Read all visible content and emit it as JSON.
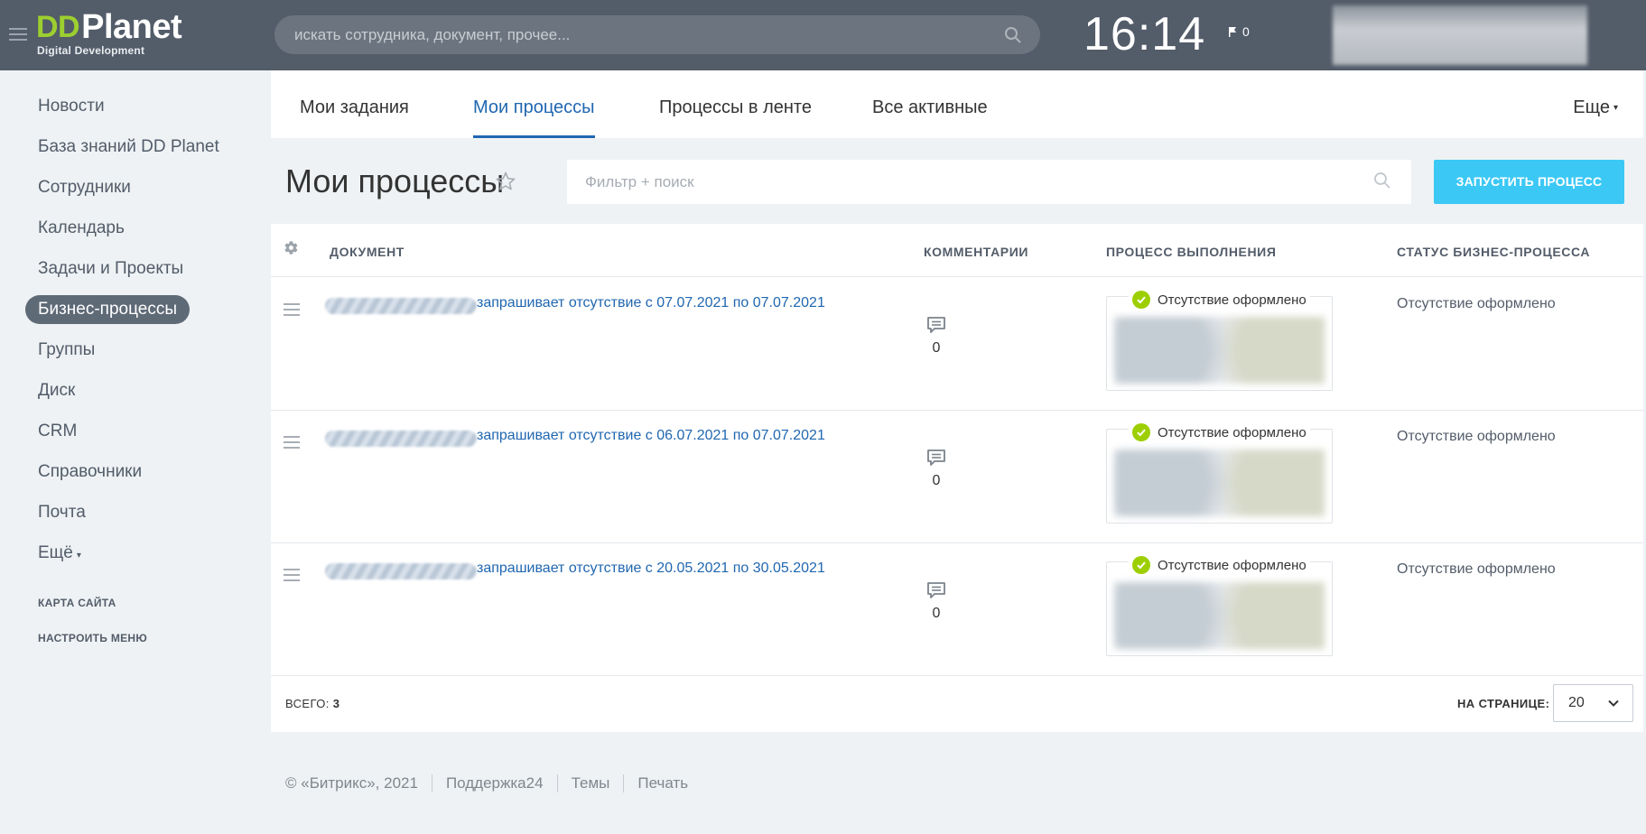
{
  "header": {
    "logo_dd": "DD",
    "logo_name": "Planet",
    "logo_sub": "Digital Development",
    "search_placeholder": "искать сотрудника, документ, прочее...",
    "time": "16:14",
    "flag_count": "0"
  },
  "sidebar": {
    "items": [
      {
        "label": "Новости"
      },
      {
        "label": "База знаний DD Planet"
      },
      {
        "label": "Сотрудники"
      },
      {
        "label": "Календарь"
      },
      {
        "label": "Задачи и Проекты"
      },
      {
        "label": "Бизнес-процессы"
      },
      {
        "label": "Группы"
      },
      {
        "label": "Диск"
      },
      {
        "label": "CRM"
      },
      {
        "label": "Справочники"
      },
      {
        "label": "Почта"
      },
      {
        "label": "Ещё"
      }
    ],
    "sitemap": "КАРТА САЙТА",
    "configure": "НАСТРОИТЬ МЕНЮ"
  },
  "tabs": {
    "items": [
      {
        "label": "Мои задания"
      },
      {
        "label": "Мои процессы"
      },
      {
        "label": "Процессы в ленте"
      },
      {
        "label": "Все активные"
      }
    ],
    "more": "Еще"
  },
  "page": {
    "title": "Мои процессы",
    "filter_placeholder": "Фильтр + поиск",
    "start_button": "ЗАПУСТИТЬ ПРОЦЕСС"
  },
  "grid": {
    "columns": {
      "document": "ДОКУМЕНТ",
      "comments": "КОММЕНТАРИИ",
      "process": "ПРОЦЕСС ВЫПОЛНЕНИЯ",
      "status": "СТАТУС БИЗНЕС-ПРОЦЕССА"
    },
    "rows": [
      {
        "document": "запрашивает отсутствие с 07.07.2021 по 07.07.2021",
        "comments": "0",
        "process_status": "Отсутствие оформлено",
        "biz_status": "Отсутствие оформлено"
      },
      {
        "document": "запрашивает отсутствие с 06.07.2021 по 07.07.2021",
        "comments": "0",
        "process_status": "Отсутствие оформлено",
        "biz_status": "Отсутствие оформлено"
      },
      {
        "document": "запрашивает отсутствие с 20.05.2021 по 30.05.2021",
        "comments": "0",
        "process_status": "Отсутствие оформлено",
        "biz_status": "Отсутствие оформлено"
      }
    ],
    "total_label": "ВСЕГО:",
    "total_value": "3",
    "per_page_label": "НА СТРАНИЦЕ:",
    "per_page_value": "20"
  },
  "footer": {
    "copyright": "© «Битрикс», 2021",
    "support": "Поддержка24",
    "themes": "Темы",
    "print": "Печать"
  },
  "colors": {
    "header_bg": "#535c69",
    "accent_blue": "#2067b0",
    "button_cyan": "#3bc8f5",
    "check_green": "#9dcf00"
  }
}
